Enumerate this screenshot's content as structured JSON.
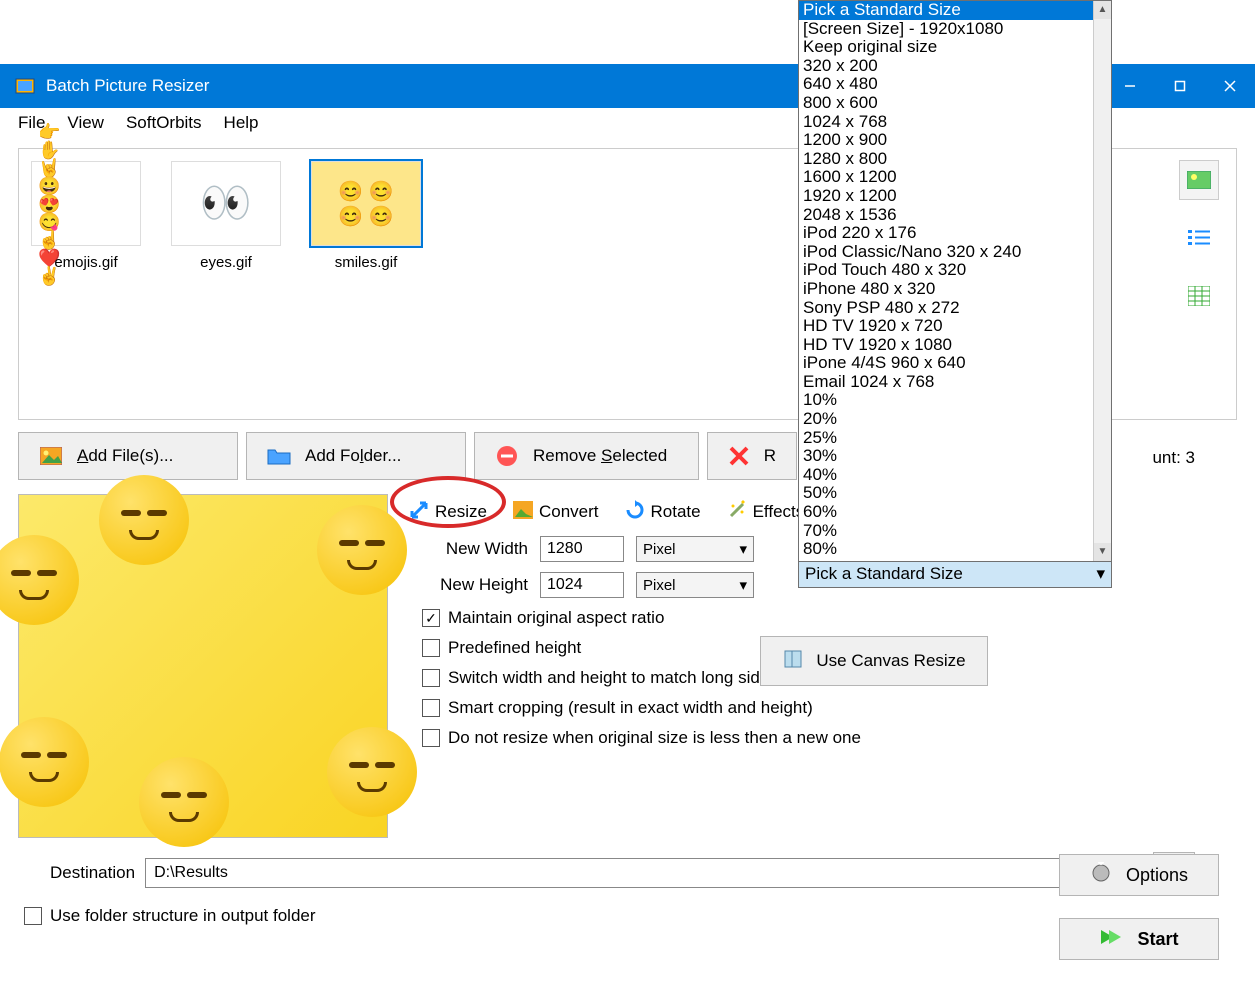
{
  "window": {
    "title": "Batch Picture Resizer"
  },
  "menu": {
    "file": "File",
    "view": "View",
    "softorbits": "SoftOrbits",
    "help": "Help"
  },
  "thumbs": [
    {
      "label": "emojis.gif"
    },
    {
      "label": "eyes.gif"
    },
    {
      "label": "smiles.gif"
    }
  ],
  "toolbar": {
    "add_files": "Add File(s)...",
    "add_folder": "Add Folder...",
    "remove_selected": "Remove Selected",
    "remove_prefix": "R"
  },
  "count_suffix": "unt: 3",
  "tabs": {
    "resize": "Resize",
    "convert": "Convert",
    "rotate": "Rotate",
    "effects": "Effects"
  },
  "form": {
    "new_width_label": "New Width",
    "new_width_value": "1280",
    "new_height_label": "New Height",
    "new_height_value": "1024",
    "unit": "Pixel",
    "maintain_ar": "Maintain original aspect ratio",
    "predef_height": "Predefined height",
    "switch_wh": "Switch width and height to match long sides",
    "smart_crop": "Smart cropping (result in exact width and height)",
    "no_upscale": "Do not resize when original size is less then a new one",
    "canvas_resize": "Use Canvas Resize"
  },
  "dest": {
    "label": "Destination",
    "value": "D:\\Results"
  },
  "use_folder_structure": "Use folder structure in output folder",
  "options": "Options",
  "start": "Start",
  "size_combo_label": "Pick a Standard Size",
  "sizes": [
    "Pick a Standard Size",
    "[Screen Size] - 1920x1080",
    "Keep original size",
    "320 x 200",
    "640 x 480",
    "800 x 600",
    "1024 x 768",
    "1200 x 900",
    "1280 x 800",
    "1600 x 1200",
    "1920 x 1200",
    "2048 x 1536",
    "iPod 220 x 176",
    "iPod Classic/Nano 320 x 240",
    "iPod Touch 480 x 320",
    "iPhone 480 x 320",
    "Sony PSP 480 x 272",
    "HD TV 1920 x 720",
    "HD TV 1920 x 1080",
    "iPone 4/4S 960 x 640",
    "Email 1024 x 768",
    "10%",
    "20%",
    "25%",
    "30%",
    "40%",
    "50%",
    "60%",
    "70%",
    "80%"
  ]
}
